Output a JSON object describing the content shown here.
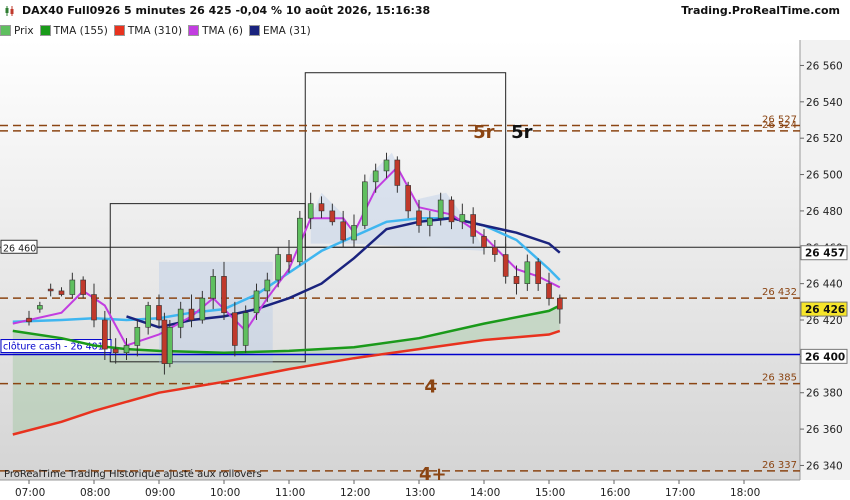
{
  "header": {
    "title": "DAX40 Full0926 5 minutes 26 425 -0,04 % 10 août 2026, 15:16:38",
    "brand": "Trading.ProRealTime.com"
  },
  "legend": [
    {
      "label": "Prix",
      "color": "#5fbf5f"
    },
    {
      "label": "TMA (155)",
      "color": "#1a9a1a"
    },
    {
      "label": "TMA (310)",
      "color": "#e8321e"
    },
    {
      "label": "TMA (6)",
      "color": "#c23de0"
    },
    {
      "label": "EMA (31)",
      "color": "#1a237e"
    }
  ],
  "footer": "ProRealTime Trading  Historique ajusté aux rollovers",
  "colors": {
    "up": "#5fbf5f",
    "down": "#c0392b",
    "tma155": "#1a9a1a",
    "tma310": "#e8321e",
    "tma6": "#c23de0",
    "ema31": "#1a237e",
    "cyan": "#3fb6f0",
    "level": "#8b4513",
    "cash": "#0000cc"
  },
  "chart_data": {
    "type": "candlestick",
    "x_ticks": [
      "07:00",
      "08:00",
      "09:00",
      "10:00",
      "11:00",
      "12:00",
      "13:00",
      "14:00",
      "15:00",
      "16:00",
      "17:00",
      "18:00"
    ],
    "y_ticks": [
      26340,
      26360,
      26380,
      26400,
      26420,
      26440,
      26460,
      26480,
      26500,
      26520,
      26540,
      26560
    ],
    "ylim": [
      26332,
      26574
    ],
    "last_price_label": "26 426",
    "levels": [
      {
        "value": 26527,
        "label": "26 527",
        "marker": "5r"
      },
      {
        "value": 26524,
        "label": "26 524",
        "marker": "5r"
      },
      {
        "value": 26432,
        "label": "26 432",
        "marker": ""
      },
      {
        "value": 26385,
        "label": "26 385",
        "marker": "4"
      },
      {
        "value": 26337,
        "label": "26 337",
        "marker": "4+"
      }
    ],
    "reference_lines": [
      {
        "value": 26460,
        "label": "26 460",
        "price_label": "26 457"
      },
      {
        "value": 26401,
        "label": "clôture cash  -  26 401",
        "price_label": "26 400"
      }
    ],
    "series": {
      "candles": [
        {
          "t": "07:00",
          "o": 26421,
          "h": 26425,
          "l": 26417,
          "c": 26419
        },
        {
          "t": "07:10",
          "o": 26426,
          "h": 26430,
          "l": 26424,
          "c": 26428
        },
        {
          "t": "07:20",
          "o": 26437,
          "h": 26440,
          "l": 26433,
          "c": 26436
        },
        {
          "t": "07:30",
          "o": 26436,
          "h": 26438,
          "l": 26433,
          "c": 26434
        },
        {
          "t": "07:40",
          "o": 26434,
          "h": 26446,
          "l": 26432,
          "c": 26442
        },
        {
          "t": "07:50",
          "o": 26442,
          "h": 26444,
          "l": 26432,
          "c": 26434
        },
        {
          "t": "08:00",
          "o": 26434,
          "h": 26440,
          "l": 26416,
          "c": 26420
        },
        {
          "t": "08:10",
          "o": 26420,
          "h": 26425,
          "l": 26398,
          "c": 26404
        },
        {
          "t": "08:20",
          "o": 26404,
          "h": 26410,
          "l": 26396,
          "c": 26402
        },
        {
          "t": "08:30",
          "o": 26402,
          "h": 26410,
          "l": 26398,
          "c": 26406
        },
        {
          "t": "08:40",
          "o": 26406,
          "h": 26420,
          "l": 26400,
          "c": 26416
        },
        {
          "t": "08:50",
          "o": 26416,
          "h": 26430,
          "l": 26412,
          "c": 26428
        },
        {
          "t": "09:00",
          "o": 26428,
          "h": 26434,
          "l": 26416,
          "c": 26420
        },
        {
          "t": "09:05",
          "o": 26420,
          "h": 26424,
          "l": 26390,
          "c": 26396
        },
        {
          "t": "09:10",
          "o": 26396,
          "h": 26420,
          "l": 26394,
          "c": 26416
        },
        {
          "t": "09:20",
          "o": 26416,
          "h": 26430,
          "l": 26410,
          "c": 26426
        },
        {
          "t": "09:30",
          "o": 26426,
          "h": 26434,
          "l": 26416,
          "c": 26420
        },
        {
          "t": "09:40",
          "o": 26420,
          "h": 26436,
          "l": 26418,
          "c": 26432
        },
        {
          "t": "09:50",
          "o": 26432,
          "h": 26448,
          "l": 26426,
          "c": 26444
        },
        {
          "t": "10:00",
          "o": 26444,
          "h": 26452,
          "l": 26420,
          "c": 26424
        },
        {
          "t": "10:10",
          "o": 26424,
          "h": 26430,
          "l": 26400,
          "c": 26406
        },
        {
          "t": "10:20",
          "o": 26406,
          "h": 26428,
          "l": 26402,
          "c": 26424
        },
        {
          "t": "10:30",
          "o": 26424,
          "h": 26440,
          "l": 26420,
          "c": 26436
        },
        {
          "t": "10:40",
          "o": 26436,
          "h": 26446,
          "l": 26430,
          "c": 26442
        },
        {
          "t": "10:50",
          "o": 26442,
          "h": 26460,
          "l": 26438,
          "c": 26456
        },
        {
          "t": "11:00",
          "o": 26456,
          "h": 26464,
          "l": 26446,
          "c": 26452
        },
        {
          "t": "11:10",
          "o": 26452,
          "h": 26480,
          "l": 26450,
          "c": 26476
        },
        {
          "t": "11:20",
          "o": 26476,
          "h": 26490,
          "l": 26470,
          "c": 26484
        },
        {
          "t": "11:30",
          "o": 26484,
          "h": 26488,
          "l": 26476,
          "c": 26480
        },
        {
          "t": "11:40",
          "o": 26480,
          "h": 26484,
          "l": 26472,
          "c": 26474
        },
        {
          "t": "11:50",
          "o": 26474,
          "h": 26480,
          "l": 26460,
          "c": 26464
        },
        {
          "t": "12:00",
          "o": 26464,
          "h": 26478,
          "l": 26460,
          "c": 26472
        },
        {
          "t": "12:10",
          "o": 26472,
          "h": 26500,
          "l": 26470,
          "c": 26496
        },
        {
          "t": "12:20",
          "o": 26496,
          "h": 26506,
          "l": 26490,
          "c": 26502
        },
        {
          "t": "12:30",
          "o": 26502,
          "h": 26512,
          "l": 26498,
          "c": 26508
        },
        {
          "t": "12:40",
          "o": 26508,
          "h": 26510,
          "l": 26490,
          "c": 26494
        },
        {
          "t": "12:50",
          "o": 26494,
          "h": 26496,
          "l": 26476,
          "c": 26480
        },
        {
          "t": "13:00",
          "o": 26480,
          "h": 26486,
          "l": 26468,
          "c": 26472
        },
        {
          "t": "13:10",
          "o": 26472,
          "h": 26480,
          "l": 26466,
          "c": 26476
        },
        {
          "t": "13:20",
          "o": 26476,
          "h": 26490,
          "l": 26472,
          "c": 26486
        },
        {
          "t": "13:30",
          "o": 26486,
          "h": 26488,
          "l": 26470,
          "c": 26474
        },
        {
          "t": "13:40",
          "o": 26474,
          "h": 26484,
          "l": 26470,
          "c": 26478
        },
        {
          "t": "13:50",
          "o": 26478,
          "h": 26482,
          "l": 26462,
          "c": 26466
        },
        {
          "t": "14:00",
          "o": 26466,
          "h": 26470,
          "l": 26456,
          "c": 26460
        },
        {
          "t": "14:10",
          "o": 26460,
          "h": 26464,
          "l": 26452,
          "c": 26456
        },
        {
          "t": "14:20",
          "o": 26456,
          "h": 26462,
          "l": 26440,
          "c": 26444
        },
        {
          "t": "14:30",
          "o": 26444,
          "h": 26450,
          "l": 26434,
          "c": 26440
        },
        {
          "t": "14:40",
          "o": 26440,
          "h": 26456,
          "l": 26436,
          "c": 26452
        },
        {
          "t": "14:50",
          "o": 26452,
          "h": 26454,
          "l": 26436,
          "c": 26440
        },
        {
          "t": "15:00",
          "o": 26440,
          "h": 26446,
          "l": 26428,
          "c": 26432
        },
        {
          "t": "15:10",
          "o": 26432,
          "h": 26434,
          "l": 26418,
          "c": 26426
        }
      ],
      "tma155": [
        [
          "06:45",
          26414
        ],
        [
          "07:30",
          26410
        ],
        [
          "08:00",
          26406
        ],
        [
          "08:30",
          26404
        ],
        [
          "09:00",
          26403
        ],
        [
          "10:00",
          26402
        ],
        [
          "11:00",
          26403
        ],
        [
          "12:00",
          26405
        ],
        [
          "13:00",
          26410
        ],
        [
          "14:00",
          26418
        ],
        [
          "15:00",
          26425
        ],
        [
          "15:10",
          26428
        ]
      ],
      "tma310": [
        [
          "06:45",
          26357
        ],
        [
          "07:30",
          26364
        ],
        [
          "08:00",
          26370
        ],
        [
          "09:00",
          26380
        ],
        [
          "10:00",
          26386
        ],
        [
          "11:00",
          26393
        ],
        [
          "12:00",
          26399
        ],
        [
          "13:00",
          26404
        ],
        [
          "14:00",
          26409
        ],
        [
          "15:00",
          26412
        ],
        [
          "15:10",
          26414
        ]
      ],
      "tma6": [
        [
          "06:45",
          26418
        ],
        [
          "07:30",
          26424
        ],
        [
          "07:50",
          26436
        ],
        [
          "08:10",
          26428
        ],
        [
          "08:30",
          26406
        ],
        [
          "09:00",
          26412
        ],
        [
          "09:30",
          26422
        ],
        [
          "09:50",
          26432
        ],
        [
          "10:20",
          26414
        ],
        [
          "10:40",
          26432
        ],
        [
          "11:00",
          26448
        ],
        [
          "11:20",
          26476
        ],
        [
          "11:50",
          26476
        ],
        [
          "12:00",
          26468
        ],
        [
          "12:20",
          26492
        ],
        [
          "12:40",
          26504
        ],
        [
          "13:00",
          26482
        ],
        [
          "13:30",
          26478
        ],
        [
          "14:00",
          26466
        ],
        [
          "14:30",
          26448
        ],
        [
          "14:50",
          26444
        ],
        [
          "15:10",
          26438
        ]
      ],
      "ema31": [
        [
          "08:30",
          26422
        ],
        [
          "09:00",
          26416
        ],
        [
          "09:30",
          26420
        ],
        [
          "10:00",
          26422
        ],
        [
          "10:30",
          26426
        ],
        [
          "11:00",
          26432
        ],
        [
          "11:30",
          26440
        ],
        [
          "12:00",
          26454
        ],
        [
          "12:30",
          26470
        ],
        [
          "13:00",
          26474
        ],
        [
          "13:30",
          26476
        ],
        [
          "14:00",
          26472
        ],
        [
          "14:30",
          26468
        ],
        [
          "15:00",
          26462
        ],
        [
          "15:10",
          26457
        ]
      ],
      "cyan": [
        [
          "06:45",
          26419
        ],
        [
          "07:30",
          26420
        ],
        [
          "08:00",
          26421
        ],
        [
          "08:30",
          26420
        ],
        [
          "09:00",
          26421
        ],
        [
          "09:30",
          26424
        ],
        [
          "10:00",
          26426
        ],
        [
          "10:30",
          26434
        ],
        [
          "11:00",
          26446
        ],
        [
          "11:30",
          26458
        ],
        [
          "12:00",
          26466
        ],
        [
          "12:30",
          26474
        ],
        [
          "13:00",
          26476
        ],
        [
          "13:30",
          26476
        ],
        [
          "14:00",
          26472
        ],
        [
          "14:30",
          26464
        ],
        [
          "15:00",
          26448
        ],
        [
          "15:10",
          26442
        ]
      ]
    }
  }
}
